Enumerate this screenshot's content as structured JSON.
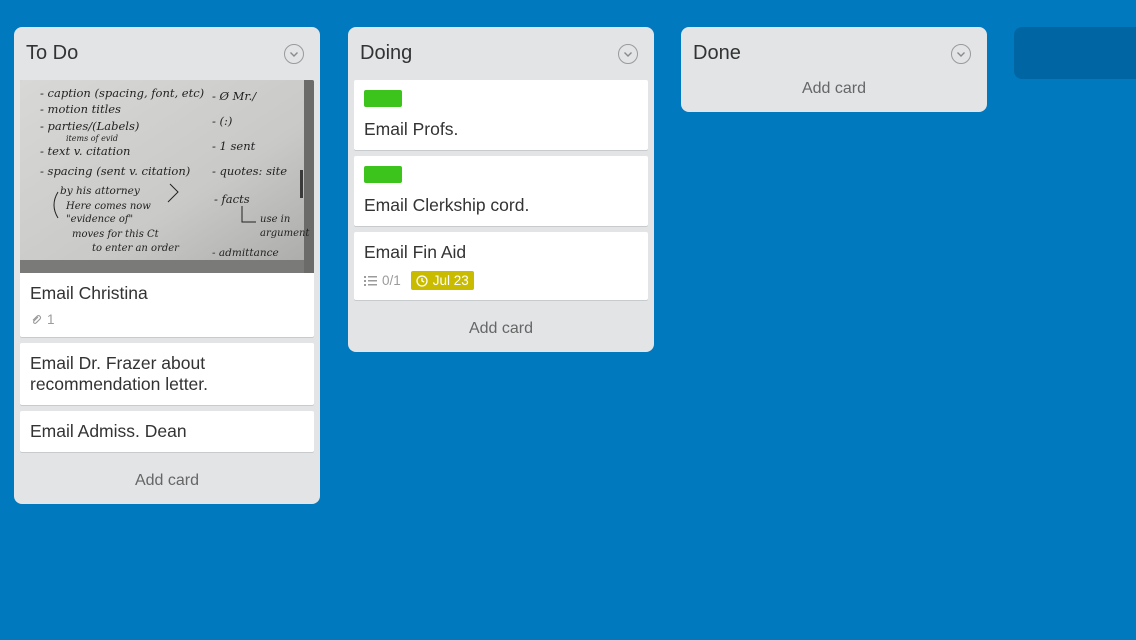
{
  "lists": [
    {
      "title": "To Do",
      "add_card": "Add card",
      "cards": [
        {
          "title": "Email Christina",
          "attachments": "1",
          "whiteboard": [
            "- caption (spacing, font, etc)",
            "- motion titles",
            "- parties/(Labels)",
            "items of evid",
            "- text v. citation",
            "- spacing (sent v. citation)",
            "by his attorney",
            "Here comes now",
            "\"evidence of\"",
            "moves for this Ct",
            "to enter an order",
            "- Ø Mr./",
            "- (:)",
            "- 1 sent",
            "- quotes: site",
            "- facts",
            "use in",
            "argument",
            "- admittance"
          ]
        },
        {
          "title": "Email Dr. Frazer about recommendation letter."
        },
        {
          "title": "Email Admiss. Dean"
        }
      ]
    },
    {
      "title": "Doing",
      "add_card": "Add card",
      "cards": [
        {
          "title": "Email Profs.",
          "label_color": "#3cc41c"
        },
        {
          "title": "Email Clerkship cord.",
          "label_color": "#3cc41c"
        },
        {
          "title": "Email Fin Aid",
          "checklist": "0/1",
          "due": "Jul 23",
          "due_color": "#c9bb00"
        }
      ]
    },
    {
      "title": "Done",
      "add_card": "Add card",
      "cards": []
    }
  ],
  "colors": {
    "board_background": "#0079bf",
    "list_background": "#e2e4e6",
    "label_green": "#3cc41c",
    "due_badge": "#c9bb00"
  }
}
